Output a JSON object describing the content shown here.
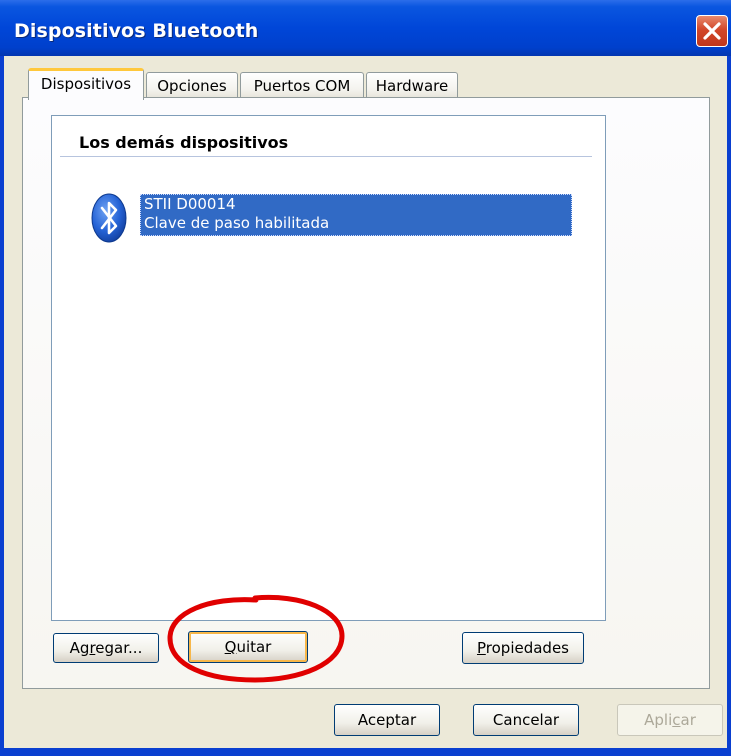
{
  "window": {
    "title": "Dispositivos Bluetooth"
  },
  "tabs": [
    {
      "label": "Dispositivos",
      "active": true
    },
    {
      "label": "Opciones",
      "active": false
    },
    {
      "label": "Puertos COM",
      "active": false
    },
    {
      "label": "Hardware",
      "active": false
    }
  ],
  "device_list": {
    "group_header": "Los demás dispositivos",
    "items": [
      {
        "name": "STII D00014",
        "status": "Clave de paso habilitada",
        "icon": "bluetooth-icon",
        "selected": true
      }
    ]
  },
  "panel_buttons": {
    "add": {
      "label": "Agregar...",
      "mnemonic": "r"
    },
    "remove": {
      "label": "Quitar",
      "mnemonic": "Q"
    },
    "properties": {
      "label": "Propiedades",
      "mnemonic": "P"
    }
  },
  "dialog_buttons": {
    "ok": {
      "label": "Aceptar"
    },
    "cancel": {
      "label": "Cancelar"
    },
    "apply": {
      "label": "Aplicar",
      "mnemonic": "c",
      "disabled": true
    }
  },
  "colors": {
    "titlebar": "#0046d8",
    "selection": "#316ac5",
    "annotation": "#e00000",
    "tab_highlight": "#ffc83c"
  }
}
